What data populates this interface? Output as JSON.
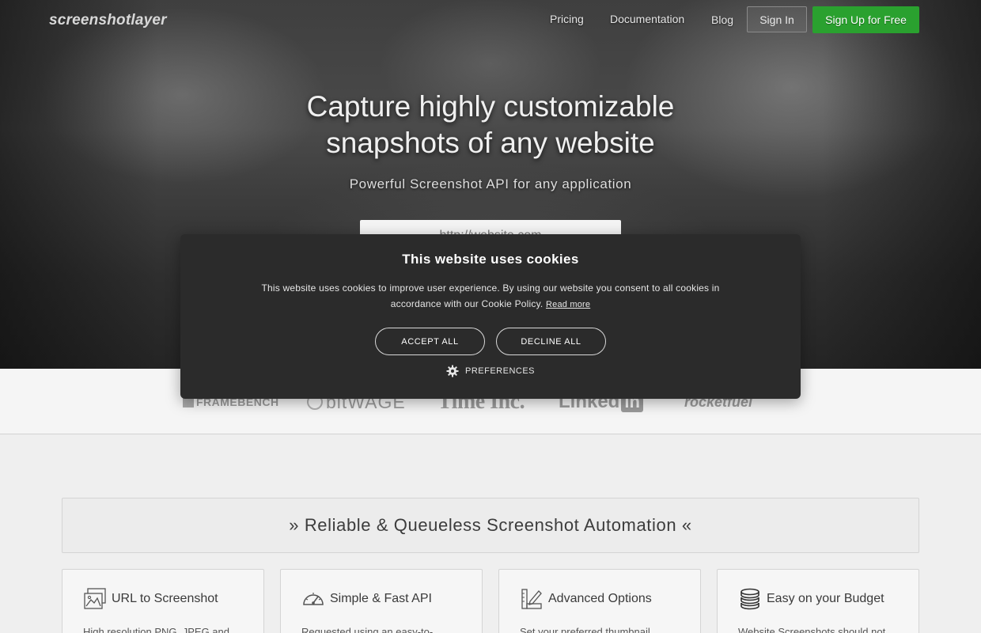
{
  "header": {
    "logo": "screenshotlayer",
    "nav": [
      "Pricing",
      "Documentation",
      "Blog"
    ],
    "signin_label": "Sign In",
    "signup_label": "Sign Up for Free"
  },
  "hero": {
    "title_line1": "Capture highly customizable",
    "title_line2": "snapshots of any website",
    "subtitle": "Powerful Screenshot API for any application",
    "url_placeholder": "http://website.com"
  },
  "clients": [
    "FRAMEBENCH",
    "bitWAGE",
    "Time Inc.",
    "Linked",
    "in",
    "rocketfuel"
  ],
  "cookie_dialog": {
    "title": "This website uses cookies",
    "text": "This website uses cookies to improve user experience. By using our website you consent to all cookies in accordance with our Cookie Policy.",
    "read_more": "Read more",
    "accept_label": "ACCEPT ALL",
    "decline_label": "DECLINE ALL",
    "preferences_label": "PREFERENCES",
    "icons": {
      "preferences": "gear-icon"
    }
  },
  "section": {
    "banner": "» Reliable & Queueless Screenshot Automation «",
    "features": [
      {
        "icon": "images-icon",
        "title": "URL to Screenshot",
        "text": "High resolution PNG, JPEG and"
      },
      {
        "icon": "speedometer-icon",
        "title": "Simple & Fast API",
        "text": "Requested using an easy-to-"
      },
      {
        "icon": "ruler-pencil-icon",
        "title": "Advanced Options",
        "text": "Set your preferred thumbnail"
      },
      {
        "icon": "coins-icon",
        "title": "Easy on your Budget",
        "text": "Website Screenshots should not"
      }
    ]
  },
  "colors": {
    "signup_green": "#2aa12f",
    "dialog_bg": "#2b2b2b",
    "page_bg": "#efefef"
  }
}
